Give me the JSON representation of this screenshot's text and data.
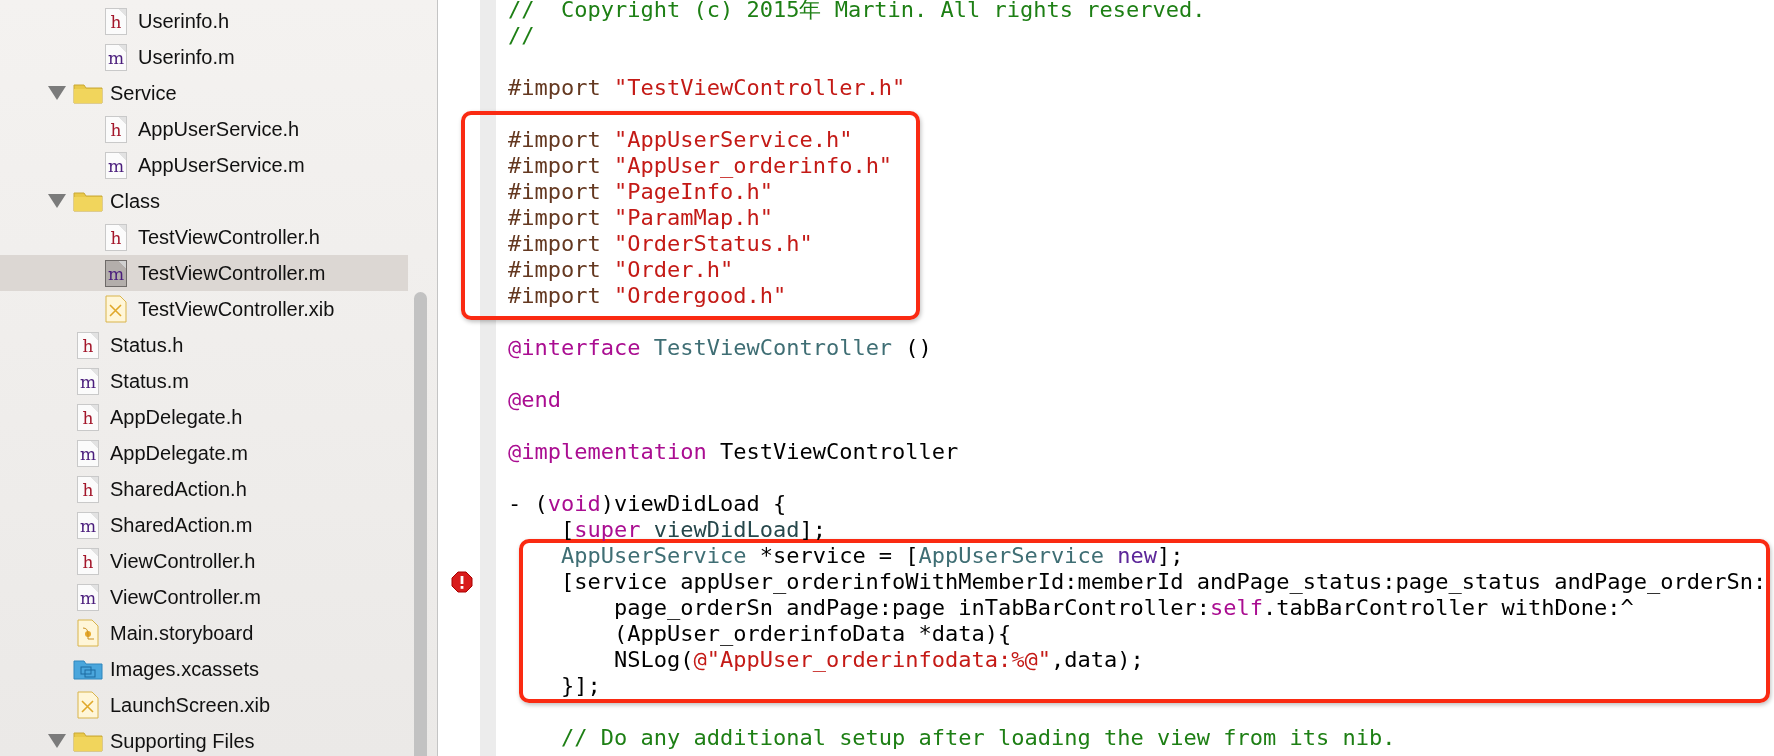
{
  "navigator": {
    "continued_items": [
      {
        "name": "Userinfo.h",
        "kind": "source",
        "glyph": "h",
        "color": "#a3162a",
        "selected": false
      },
      {
        "name": "Userinfo.m",
        "kind": "source",
        "glyph": "m",
        "color": "#4a1d7c",
        "selected": false
      }
    ],
    "items": [
      {
        "name": "Service",
        "kind": "folder",
        "expanded": true,
        "selected": false,
        "children": [
          {
            "name": "AppUserService.h",
            "kind": "source",
            "glyph": "h",
            "color": "#a3162a",
            "selected": false
          },
          {
            "name": "AppUserService.m",
            "kind": "source",
            "glyph": "m",
            "color": "#4a1d7c",
            "selected": false
          }
        ]
      },
      {
        "name": "Class",
        "kind": "folder",
        "expanded": true,
        "selected": false,
        "children": [
          {
            "name": "TestViewController.h",
            "kind": "source",
            "glyph": "h",
            "color": "#a3162a",
            "selected": false
          },
          {
            "name": "TestViewController.m",
            "kind": "source",
            "glyph": "m",
            "color": "#4a1d7c",
            "selected": true
          },
          {
            "name": "TestViewController.xib",
            "kind": "xib",
            "selected": false
          }
        ]
      },
      {
        "name": "Status.h",
        "kind": "source",
        "glyph": "h",
        "color": "#a3162a",
        "selected": false
      },
      {
        "name": "Status.m",
        "kind": "source",
        "glyph": "m",
        "color": "#4a1d7c",
        "selected": false
      },
      {
        "name": "AppDelegate.h",
        "kind": "source",
        "glyph": "h",
        "color": "#a3162a",
        "selected": false
      },
      {
        "name": "AppDelegate.m",
        "kind": "source",
        "glyph": "m",
        "color": "#4a1d7c",
        "selected": false
      },
      {
        "name": "SharedAction.h",
        "kind": "source",
        "glyph": "h",
        "color": "#a3162a",
        "selected": false
      },
      {
        "name": "SharedAction.m",
        "kind": "source",
        "glyph": "m",
        "color": "#4a1d7c",
        "selected": false
      },
      {
        "name": "ViewController.h",
        "kind": "source",
        "glyph": "h",
        "color": "#a3162a",
        "selected": false
      },
      {
        "name": "ViewController.m",
        "kind": "source",
        "glyph": "m",
        "color": "#4a1d7c",
        "selected": false
      },
      {
        "name": "Main.storyboard",
        "kind": "storyboard",
        "selected": false
      },
      {
        "name": "Images.xcassets",
        "kind": "assets",
        "selected": false
      },
      {
        "name": "LaunchScreen.xib",
        "kind": "xib",
        "selected": false
      },
      {
        "name": "Supporting Files",
        "kind": "folder",
        "expanded": true,
        "selected": false
      }
    ]
  },
  "editor": {
    "blocks": [
      {
        "kind": "plain",
        "lines": [
          {
            "kind": "code",
            "error": false,
            "tokens": [
              {
                "text": "//  Copyright (c) 2015年 Martin. All rights reserved.",
                "kind": "comment"
              }
            ]
          },
          {
            "kind": "code",
            "error": false,
            "tokens": [
              {
                "text": "//",
                "kind": "comment"
              }
            ]
          },
          {
            "kind": "blank"
          },
          {
            "kind": "code",
            "error": false,
            "tokens": [
              {
                "text": "#import ",
                "kind": "directive"
              },
              {
                "text": "\"TestViewController.h\"",
                "kind": "string"
              }
            ]
          },
          {
            "kind": "blank"
          }
        ]
      },
      {
        "kind": "boxed",
        "lines": [
          {
            "kind": "code",
            "error": false,
            "tokens": [
              {
                "text": "#import ",
                "kind": "directive"
              },
              {
                "text": "\"AppUserService.h\"",
                "kind": "string"
              }
            ]
          },
          {
            "kind": "code",
            "error": false,
            "tokens": [
              {
                "text": "#import ",
                "kind": "directive"
              },
              {
                "text": "\"AppUser_orderinfo.h\"",
                "kind": "string"
              }
            ]
          },
          {
            "kind": "code",
            "error": false,
            "tokens": [
              {
                "text": "#import ",
                "kind": "directive"
              },
              {
                "text": "\"PageInfo.h\"",
                "kind": "string"
              }
            ]
          },
          {
            "kind": "code",
            "error": false,
            "tokens": [
              {
                "text": "#import ",
                "kind": "directive"
              },
              {
                "text": "\"ParamMap.h\"",
                "kind": "string"
              }
            ]
          },
          {
            "kind": "code",
            "error": false,
            "tokens": [
              {
                "text": "#import ",
                "kind": "directive"
              },
              {
                "text": "\"OrderStatus.h\"",
                "kind": "string"
              }
            ]
          },
          {
            "kind": "code",
            "error": false,
            "tokens": [
              {
                "text": "#import ",
                "kind": "directive"
              },
              {
                "text": "\"Order.h\"",
                "kind": "string"
              }
            ]
          },
          {
            "kind": "code",
            "error": false,
            "tokens": [
              {
                "text": "#import ",
                "kind": "directive"
              },
              {
                "text": "\"Ordergood.h\"",
                "kind": "string"
              }
            ]
          }
        ]
      },
      {
        "kind": "plain",
        "lines": [
          {
            "kind": "blank"
          },
          {
            "kind": "code",
            "error": false,
            "tokens": [
              {
                "text": "@interface ",
                "kind": "keyword"
              },
              {
                "text": "TestViewController",
                "kind": "class"
              },
              {
                "text": " ()",
                "kind": "plain"
              }
            ]
          },
          {
            "kind": "blank"
          },
          {
            "kind": "code",
            "error": false,
            "tokens": [
              {
                "text": "@end",
                "kind": "keyword"
              }
            ]
          },
          {
            "kind": "blank"
          },
          {
            "kind": "code",
            "error": false,
            "tokens": [
              {
                "text": "@implementation",
                "kind": "keyword"
              },
              {
                "text": " TestViewController",
                "kind": "plain"
              }
            ]
          },
          {
            "kind": "blank"
          },
          {
            "kind": "code",
            "error": false,
            "tokens": [
              {
                "text": "- (",
                "kind": "plain"
              },
              {
                "text": "void",
                "kind": "keyword"
              },
              {
                "text": ")viewDidLoad {",
                "kind": "plain"
              }
            ]
          },
          {
            "kind": "code",
            "error": false,
            "tokens": [
              {
                "text": "    [",
                "kind": "plain"
              },
              {
                "text": "super ",
                "kind": "keyword"
              },
              {
                "text": "viewDidLoad",
                "kind": "method"
              },
              {
                "text": "];",
                "kind": "plain"
              }
            ]
          }
        ]
      },
      {
        "kind": "boxed-wide",
        "lines": [
          {
            "kind": "code",
            "error": false,
            "tokens": [
              {
                "text": "    AppUserService",
                "kind": "class"
              },
              {
                "text": " *service = [",
                "kind": "plain"
              },
              {
                "text": "AppUserService ",
                "kind": "class"
              },
              {
                "text": "new",
                "kind": "system"
              },
              {
                "text": "];",
                "kind": "plain"
              }
            ]
          },
          {
            "kind": "code",
            "error": true,
            "tokens": [
              {
                "text": "    [service appUser_orderinfoWithMemberId:memberId andPage_status:page_status andPage_orderSn:",
                "kind": "plain"
              }
            ]
          },
          {
            "kind": "code",
            "error": false,
            "tokens": [
              {
                "text": "        page_orderSn andPage:page inTabBarController:",
                "kind": "plain"
              },
              {
                "text": "self",
                "kind": "keyword"
              },
              {
                "text": ".tabBarController withDone:^",
                "kind": "plain"
              }
            ]
          },
          {
            "kind": "code",
            "error": false,
            "tokens": [
              {
                "text": "        (AppUser_orderinfoData *data){",
                "kind": "plain"
              }
            ]
          },
          {
            "kind": "code",
            "error": false,
            "tokens": [
              {
                "text": "        NSLog(",
                "kind": "plain"
              },
              {
                "text": "@\"AppUser_orderinfodata:%@\"",
                "kind": "string"
              },
              {
                "text": ",data);",
                "kind": "plain"
              }
            ]
          },
          {
            "kind": "code",
            "error": false,
            "tokens": [
              {
                "text": "    }];",
                "kind": "plain"
              }
            ]
          }
        ]
      },
      {
        "kind": "plain",
        "lines": [
          {
            "kind": "blank"
          },
          {
            "kind": "code",
            "error": false,
            "tokens": [
              {
                "text": "    // Do any additional setup after loading the view from its nib.",
                "kind": "comment"
              }
            ]
          }
        ]
      }
    ]
  }
}
